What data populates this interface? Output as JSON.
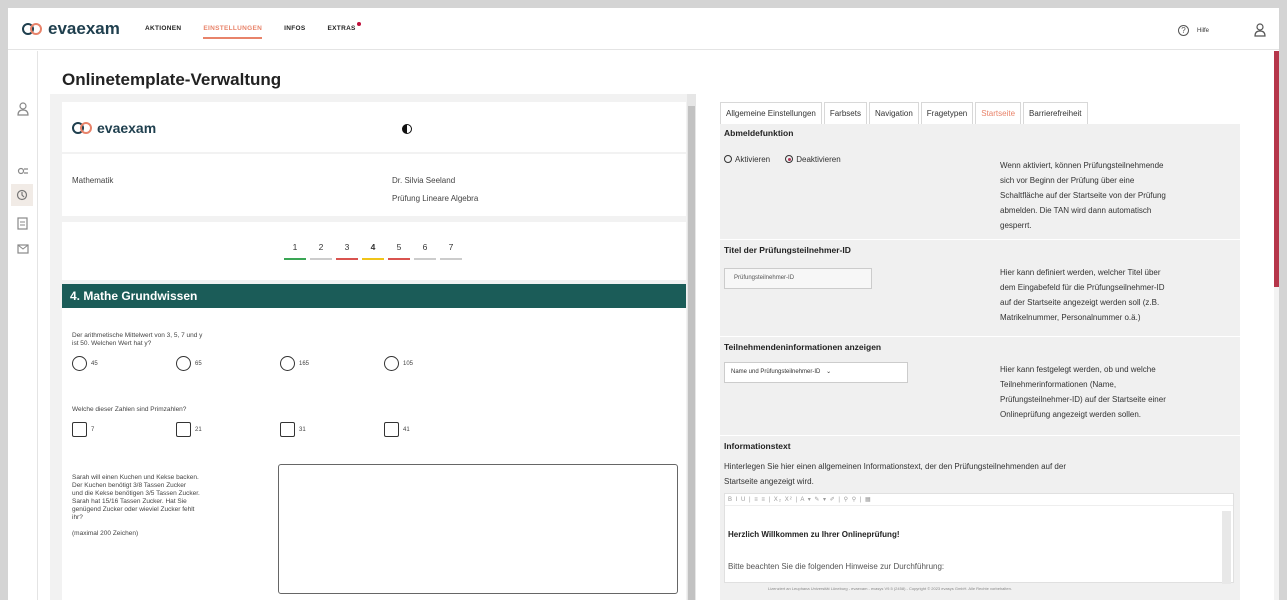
{
  "header": {
    "brand": "evaexam",
    "nav": [
      {
        "label": "AKTIONEN",
        "active": false
      },
      {
        "label": "EINSTELLUNGEN",
        "active": true
      },
      {
        "label": "INFOS",
        "active": false
      },
      {
        "label": "EXTRAS",
        "active": false,
        "badge": true
      }
    ],
    "help_label": "Hilfe"
  },
  "sidebar": {
    "items": [
      {
        "icon": "user-icon"
      },
      {
        "icon": "settings-icon"
      },
      {
        "icon": "template-icon",
        "active": true
      },
      {
        "icon": "document-icon"
      },
      {
        "icon": "mail-icon"
      }
    ]
  },
  "page": {
    "title": "Onlinetemplate-Verwaltung"
  },
  "preview": {
    "brand": "evaexam",
    "subject": "Mathematik",
    "lecturer": "Dr. Silvia Seeland",
    "exam_title": "Prüfung Lineare Algebra",
    "pages": [
      {
        "n": "1",
        "color": "#3aa655"
      },
      {
        "n": "2",
        "color": "#cccccc"
      },
      {
        "n": "3",
        "color": "#d9534f"
      },
      {
        "n": "4",
        "color": "#f0c419",
        "current": true
      },
      {
        "n": "5",
        "color": "#d9534f"
      },
      {
        "n": "6",
        "color": "#cccccc"
      },
      {
        "n": "7",
        "color": "#cccccc"
      }
    ],
    "section_title": "4. Mathe Grundwissen",
    "q1": {
      "line1": "Der arithmetische Mittelwert von 3, 5, 7 und y",
      "line2": "ist 50. Welchen Wert hat y?",
      "options": [
        "45",
        "65",
        "165",
        "105"
      ]
    },
    "q2": {
      "text": "Welche dieser Zahlen sind Primzahlen?",
      "options": [
        "7",
        "21",
        "31",
        "41"
      ]
    },
    "q3": {
      "lines": [
        "Sarah will einen Kuchen und Kekse backen.",
        "Der Kuchen benötigt 3/8 Tassen Zucker",
        "und die Kekse benötigen 3/5 Tassen Zucker.",
        "Sarah hat 15/16 Tassen Zucker. Hat Sie",
        "genügend Zucker oder wieviel Zucker fehlt",
        "ihr?"
      ],
      "limit": "(maximal 200 Zeichen)"
    }
  },
  "settings": {
    "tabs": [
      {
        "label": "Allgemeine Einstellungen",
        "active": false
      },
      {
        "label": "Farbsets",
        "active": false
      },
      {
        "label": "Navigation",
        "active": false
      },
      {
        "label": "Fragetypen",
        "active": false
      },
      {
        "label": "Startseite",
        "active": true
      },
      {
        "label": "Barrierefreiheit",
        "active": false
      }
    ],
    "abmelde": {
      "title": "Abmeldefunktion",
      "opt_on": "Aktivieren",
      "opt_off": "Deaktivieren",
      "selected": "Deaktivieren",
      "desc": [
        "Wenn aktiviert, können Prüfungsteilnehmende",
        "sich vor Beginn der Prüfung über eine",
        "Schaltfläche auf der Startseite von der Prüfung",
        "abmelden. Die TAN wird dann automatisch",
        "gesperrt."
      ]
    },
    "titel": {
      "title": "Titel der Prüfungsteilnehmer-ID",
      "value": "Prüfungsteilnehmer-ID",
      "desc": [
        "Hier kann definiert werden, welcher Titel über",
        "dem Eingabefeld für die Prüfungseilnehmer-ID",
        "auf der Startseite angezeigt werden soll (z.B.",
        "Matrikelnummer, Personalnummer o.ä.)"
      ]
    },
    "teilnehmer": {
      "title": "Teilnehmendeninformationen anzeigen",
      "selected": "Name und Prüfungsteilnehmer-ID",
      "desc": [
        "Hier kann festgelegt werden, ob und welche",
        "Teilnehmerinformationen (Name,",
        "Prüfungsteilnehmer-ID) auf der Startseite einer",
        "Onlineprüfung angezeigt werden sollen."
      ]
    },
    "info": {
      "title": "Informationstext",
      "desc": [
        "Hinterlegen Sie hier einen allgemeinen Informationstext, der den Prüfungsteilnehmenden auf der",
        "Startseite angezeigt wird."
      ],
      "toolbar": "B  I  U | ≡  ≡ | X₂  X² | A ▾  ✎ ▾  ✐ | ⚲  ⚲ | ▦",
      "heading": "Herzlich Willkommen zu Ihrer Onlineprüfung!",
      "body": "Bitte beachten Sie die folgenden Hinweise zur Durchführung:"
    }
  },
  "footer": {
    "text": "Lizenziert an Leuphana Universität Lüneburg - evaexam - evasys V9.5 (2458) - Copyright © 2023 evasys GmbH. Alle Rechte vorbehalten."
  }
}
